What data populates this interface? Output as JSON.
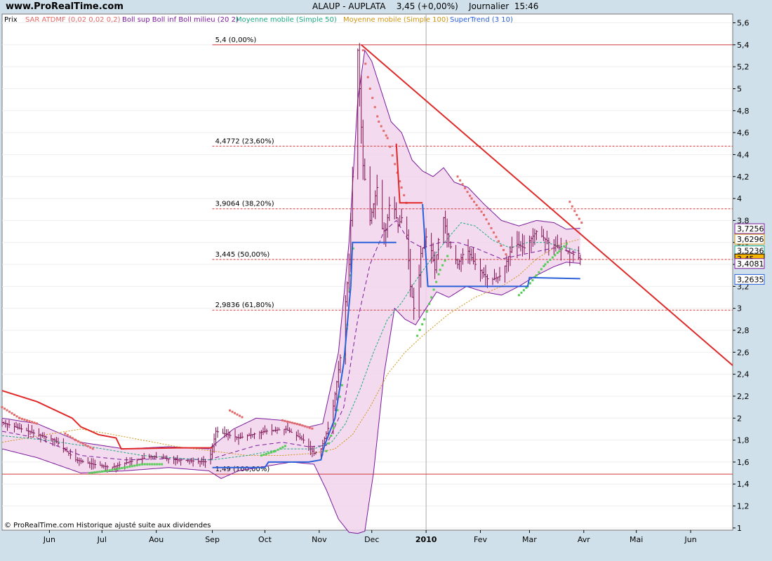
{
  "site": "www.ProRealTime.com",
  "header": {
    "symbol": "ALAUP - AUPLATA",
    "quote": "3,45 (+0,00%)",
    "period": "Journalier",
    "time": "15:46"
  },
  "footer_note": "© ProRealTime.com Historique ajusté suite aux dividendes",
  "colors": {
    "price": "#7d0f50",
    "sar": "#e36a6a",
    "boll": "#7a1a9a",
    "boll_fill": "#f1d3ec",
    "ma50": "#1aab80",
    "ma100": "#cf9410",
    "supertrend_up": "#2a60d8",
    "supertrend_down": "#e02828",
    "fib": "#d23a3a",
    "trendline": "#dd2a2a"
  },
  "chart_data": {
    "type": "line",
    "legend": [
      {
        "text": "Prix",
        "color": "#000000"
      },
      {
        "text": "SAR ATDMF (0,02 0,02 0,2)",
        "color": "#e36a6a"
      },
      {
        "text": "Boll sup Boll inf Boll milieu (20 2)",
        "color": "#7a1a9a"
      },
      {
        "text": "Moyenne mobile (Simple 50)",
        "color": "#1aab80"
      },
      {
        "text": "Moyenne mobile (Simple 100)",
        "color": "#cf9410"
      },
      {
        "text": "SuperTrend (3 10)",
        "color": "#2a60d8"
      }
    ],
    "y_ticks": [
      1,
      1.2,
      1.4,
      1.6,
      1.8,
      2,
      2.2,
      2.4,
      2.6,
      2.8,
      3,
      3.2,
      3.4,
      3.6,
      3.8,
      4,
      4.2,
      4.4,
      4.6,
      4.8,
      5,
      5.2,
      5.4,
      5.6
    ],
    "y_tick_labels": [
      "1",
      "1,2",
      "1,4",
      "1,6",
      "1,8",
      "2",
      "2,2",
      "2,4",
      "2,6",
      "2,8",
      "3",
      "3,2",
      "3,4",
      "3,6",
      "3,8",
      "4",
      "4,2",
      "4,4",
      "4,6",
      "4,8",
      "5",
      "5,2",
      "5,4",
      "5,6"
    ],
    "ylim": [
      0.98,
      5.68
    ],
    "x_labels": [
      "Jun",
      "Jul",
      "Aou",
      "Sep",
      "Oct",
      "Nov",
      "Dec",
      "2010",
      "Fev",
      "Mar",
      "Avr",
      "Mai",
      "Jun"
    ],
    "x_label_days": [
      27,
      57,
      88,
      120,
      150,
      181,
      211,
      242,
      273,
      301,
      332,
      362,
      393
    ],
    "x_range_days": [
      0,
      417
    ],
    "fib_levels": [
      {
        "value": 5.4,
        "label": "5,4 (0,00%)"
      },
      {
        "value": 4.4772,
        "label": "4,4772 (23,60%)"
      },
      {
        "value": 3.9064,
        "label": "3,9064 (38,20%)"
      },
      {
        "value": 3.445,
        "label": "3,445 (50,00%)"
      },
      {
        "value": 2.9836,
        "label": "2,9836 (61,80%)"
      },
      {
        "value": 1.49,
        "label": "1,49 (100,00%)"
      }
    ],
    "trendline": [
      {
        "day": 205,
        "y": 5.4
      },
      {
        "day": 417,
        "y": 2.48
      }
    ],
    "right_tags": [
      {
        "value": "3,7256",
        "y": 3.7256,
        "border": "#7a1a9a",
        "fill": "#ffffff"
      },
      {
        "value": "3,6296",
        "y": 3.6296,
        "border": "#cf9410",
        "fill": "#ffffff"
      },
      {
        "value": "3,5236",
        "y": 3.5236,
        "border": "#1aab80",
        "fill": "#ffffff"
      },
      {
        "value": "3,45",
        "y": 3.45,
        "border": "#000000",
        "fill": "#f4b400"
      },
      {
        "value": "3,4081",
        "y": 3.408,
        "border": "#7a1a9a",
        "fill": "#ffffff"
      },
      {
        "value": "3,2635",
        "y": 3.2635,
        "border": "#2a60d8",
        "fill": "#ffffff"
      }
    ],
    "close_anchors": [
      [
        0,
        1.96
      ],
      [
        15,
        1.88
      ],
      [
        30,
        1.8
      ],
      [
        42,
        1.62
      ],
      [
        52,
        1.58
      ],
      [
        62,
        1.55
      ],
      [
        72,
        1.6
      ],
      [
        85,
        1.65
      ],
      [
        100,
        1.62
      ],
      [
        118,
        1.6
      ],
      [
        122,
        1.88
      ],
      [
        135,
        1.82
      ],
      [
        150,
        1.88
      ],
      [
        162,
        1.9
      ],
      [
        172,
        1.8
      ],
      [
        178,
        1.68
      ],
      [
        182,
        1.72
      ],
      [
        188,
        2.0
      ],
      [
        193,
        2.55
      ],
      [
        198,
        3.4
      ],
      [
        201,
        4.6
      ],
      [
        203,
        5.35
      ],
      [
        206,
        4.3
      ],
      [
        210,
        3.8
      ],
      [
        214,
        4.1
      ],
      [
        218,
        3.6
      ],
      [
        222,
        4.05
      ],
      [
        226,
        3.75
      ],
      [
        230,
        3.9
      ],
      [
        233,
        3.2
      ],
      [
        236,
        2.9
      ],
      [
        239,
        3.5
      ],
      [
        243,
        3.7
      ],
      [
        247,
        3.35
      ],
      [
        251,
        3.9
      ],
      [
        255,
        3.6
      ],
      [
        260,
        3.4
      ],
      [
        265,
        3.55
      ],
      [
        270,
        3.4
      ],
      [
        278,
        3.25
      ],
      [
        285,
        3.3
      ],
      [
        292,
        3.6
      ],
      [
        298,
        3.55
      ],
      [
        305,
        3.7
      ],
      [
        312,
        3.6
      ],
      [
        318,
        3.55
      ],
      [
        325,
        3.5
      ],
      [
        330,
        3.45
      ]
    ],
    "upper_anchors": [
      [
        0,
        2.0
      ],
      [
        20,
        1.95
      ],
      [
        45,
        1.78
      ],
      [
        70,
        1.72
      ],
      [
        95,
        1.74
      ],
      [
        118,
        1.72
      ],
      [
        132,
        1.9
      ],
      [
        145,
        2.0
      ],
      [
        160,
        1.98
      ],
      [
        175,
        1.92
      ],
      [
        183,
        1.95
      ],
      [
        192,
        2.6
      ],
      [
        198,
        3.6
      ],
      [
        203,
        4.9
      ],
      [
        207,
        5.35
      ],
      [
        211,
        5.25
      ],
      [
        216,
        5.0
      ],
      [
        222,
        4.7
      ],
      [
        228,
        4.6
      ],
      [
        234,
        4.35
      ],
      [
        240,
        4.25
      ],
      [
        246,
        4.2
      ],
      [
        252,
        4.28
      ],
      [
        258,
        4.15
      ],
      [
        266,
        4.1
      ],
      [
        275,
        3.95
      ],
      [
        285,
        3.8
      ],
      [
        295,
        3.75
      ],
      [
        305,
        3.8
      ],
      [
        315,
        3.78
      ],
      [
        322,
        3.72
      ],
      [
        330,
        3.73
      ]
    ],
    "lower_anchors": [
      [
        0,
        1.72
      ],
      [
        20,
        1.64
      ],
      [
        45,
        1.5
      ],
      [
        70,
        1.52
      ],
      [
        95,
        1.55
      ],
      [
        118,
        1.52
      ],
      [
        125,
        1.45
      ],
      [
        135,
        1.52
      ],
      [
        150,
        1.56
      ],
      [
        165,
        1.6
      ],
      [
        178,
        1.58
      ],
      [
        185,
        1.35
      ],
      [
        192,
        1.08
      ],
      [
        198,
        0.96
      ],
      [
        203,
        0.95
      ],
      [
        207,
        0.97
      ],
      [
        212,
        1.5
      ],
      [
        218,
        2.4
      ],
      [
        224,
        3.0
      ],
      [
        230,
        2.9
      ],
      [
        236,
        2.85
      ],
      [
        242,
        3.0
      ],
      [
        248,
        3.15
      ],
      [
        255,
        3.1
      ],
      [
        265,
        3.2
      ],
      [
        275,
        3.15
      ],
      [
        285,
        3.12
      ],
      [
        295,
        3.2
      ],
      [
        305,
        3.3
      ],
      [
        315,
        3.38
      ],
      [
        322,
        3.42
      ],
      [
        330,
        3.41
      ]
    ],
    "mid_anchors": [
      [
        0,
        1.88
      ],
      [
        20,
        1.82
      ],
      [
        45,
        1.66
      ],
      [
        70,
        1.62
      ],
      [
        95,
        1.63
      ],
      [
        118,
        1.62
      ],
      [
        130,
        1.68
      ],
      [
        145,
        1.75
      ],
      [
        160,
        1.78
      ],
      [
        175,
        1.74
      ],
      [
        185,
        1.75
      ],
      [
        195,
        2.1
      ],
      [
        203,
        2.9
      ],
      [
        210,
        3.4
      ],
      [
        218,
        3.7
      ],
      [
        225,
        3.8
      ],
      [
        232,
        3.62
      ],
      [
        240,
        3.55
      ],
      [
        250,
        3.6
      ],
      [
        260,
        3.6
      ],
      [
        270,
        3.55
      ],
      [
        285,
        3.45
      ],
      [
        300,
        3.5
      ],
      [
        315,
        3.55
      ],
      [
        330,
        3.5
      ]
    ],
    "ma50_anchors": [
      [
        0,
        1.84
      ],
      [
        25,
        1.8
      ],
      [
        50,
        1.74
      ],
      [
        80,
        1.66
      ],
      [
        105,
        1.63
      ],
      [
        120,
        1.62
      ],
      [
        140,
        1.66
      ],
      [
        160,
        1.72
      ],
      [
        178,
        1.72
      ],
      [
        188,
        1.78
      ],
      [
        196,
        1.95
      ],
      [
        204,
        2.25
      ],
      [
        212,
        2.6
      ],
      [
        220,
        2.9
      ],
      [
        228,
        3.05
      ],
      [
        236,
        3.25
      ],
      [
        245,
        3.45
      ],
      [
        255,
        3.65
      ],
      [
        262,
        3.78
      ],
      [
        270,
        3.75
      ],
      [
        280,
        3.62
      ],
      [
        290,
        3.55
      ],
      [
        300,
        3.6
      ],
      [
        310,
        3.6
      ],
      [
        320,
        3.56
      ],
      [
        330,
        3.52
      ]
    ],
    "ma100_anchors": [
      [
        0,
        1.78
      ],
      [
        25,
        1.85
      ],
      [
        45,
        1.9
      ],
      [
        60,
        1.86
      ],
      [
        80,
        1.8
      ],
      [
        100,
        1.74
      ],
      [
        120,
        1.7
      ],
      [
        140,
        1.66
      ],
      [
        160,
        1.66
      ],
      [
        178,
        1.68
      ],
      [
        190,
        1.72
      ],
      [
        200,
        1.85
      ],
      [
        210,
        2.1
      ],
      [
        220,
        2.4
      ],
      [
        230,
        2.6
      ],
      [
        240,
        2.75
      ],
      [
        255,
        2.95
      ],
      [
        270,
        3.1
      ],
      [
        285,
        3.2
      ],
      [
        295,
        3.3
      ],
      [
        305,
        3.45
      ],
      [
        318,
        3.58
      ],
      [
        330,
        3.63
      ]
    ],
    "supertrend_segments": [
      {
        "trend": "down",
        "points": [
          [
            0,
            2.25
          ],
          [
            20,
            2.15
          ],
          [
            40,
            2.0
          ],
          [
            45,
            1.92
          ],
          [
            48,
            1.9
          ],
          [
            55,
            1.85
          ],
          [
            65,
            1.82
          ],
          [
            68,
            1.72
          ],
          [
            100,
            1.73
          ],
          [
            120,
            1.73
          ],
          [
            120,
            1.73
          ]
        ]
      },
      {
        "trend": "up",
        "points": [
          [
            120,
            1.55
          ],
          [
            150,
            1.55
          ],
          [
            152,
            1.6
          ],
          [
            175,
            1.6
          ],
          [
            182,
            1.62
          ],
          [
            184,
            1.75
          ],
          [
            190,
            2.0
          ],
          [
            195,
            2.5
          ],
          [
            199,
            3.2
          ],
          [
            200,
            3.6
          ],
          [
            225,
            3.6
          ],
          [
            225,
            3.6
          ]
        ]
      },
      {
        "trend": "down",
        "points": [
          [
            225,
            4.5
          ],
          [
            227,
            3.96
          ],
          [
            240,
            3.96
          ],
          [
            240,
            3.96
          ]
        ]
      },
      {
        "trend": "up",
        "points": [
          [
            240,
            3.95
          ],
          [
            243,
            3.2
          ],
          [
            280,
            3.2
          ],
          [
            300,
            3.2
          ],
          [
            301,
            3.28
          ],
          [
            330,
            3.27
          ]
        ]
      }
    ],
    "sar_points_up": [
      [
        30,
        1.7
      ],
      [
        50,
        1.5
      ],
      [
        60,
        1.52
      ],
      [
        70,
        1.55
      ],
      [
        80,
        1.58
      ],
      [
        92,
        1.58
      ],
      [
        148,
        1.66
      ],
      [
        156,
        1.7
      ],
      [
        162,
        1.75
      ],
      [
        185,
        1.7
      ],
      [
        190,
        1.95
      ],
      [
        194,
        2.3
      ],
      [
        197,
        2.85
      ],
      [
        199,
        3.3
      ],
      [
        201,
        3.65
      ],
      [
        237,
        2.75
      ],
      [
        241,
        2.9
      ],
      [
        245,
        3.1
      ],
      [
        250,
        3.35
      ],
      [
        255,
        3.5
      ],
      [
        295,
        3.12
      ],
      [
        300,
        3.2
      ],
      [
        305,
        3.3
      ],
      [
        310,
        3.4
      ],
      [
        318,
        3.52
      ],
      [
        323,
        3.6
      ]
    ],
    "sar_points_down": [
      [
        0,
        2.1
      ],
      [
        10,
        2.0
      ],
      [
        20,
        1.95
      ],
      [
        36,
        1.86
      ],
      [
        42,
        1.8
      ],
      [
        52,
        1.72
      ],
      [
        130,
        2.07
      ],
      [
        138,
        2.0
      ],
      [
        160,
        1.98
      ],
      [
        170,
        1.94
      ],
      [
        178,
        1.9
      ],
      [
        206,
        5.35
      ],
      [
        210,
        5.0
      ],
      [
        215,
        4.7
      ],
      [
        220,
        4.55
      ],
      [
        228,
        4.1
      ],
      [
        232,
        3.9
      ],
      [
        260,
        4.2
      ],
      [
        268,
        4.0
      ],
      [
        275,
        3.85
      ],
      [
        282,
        3.65
      ],
      [
        288,
        3.48
      ],
      [
        324,
        3.97
      ],
      [
        328,
        3.85
      ],
      [
        332,
        3.75
      ]
    ]
  }
}
